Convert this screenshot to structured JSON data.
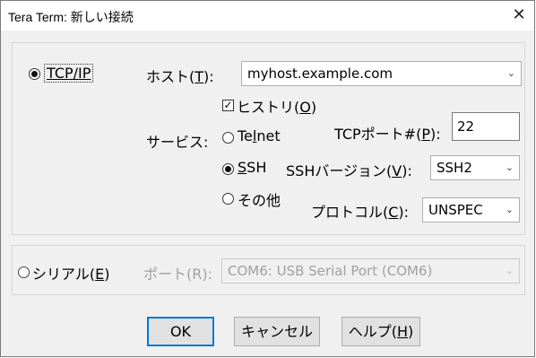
{
  "window": {
    "title": "Tera Term: 新しい接続",
    "close_glyph": "✕"
  },
  "tcpip": {
    "label": "TCP/IP",
    "selected": true,
    "host_label_prefix": "ホスト(",
    "host_label_key": "T",
    "host_label_suffix": "):",
    "host_value": "myhost.example.com",
    "history_checked": true,
    "history_label_prefix": "ヒストリ(",
    "history_label_key": "O",
    "history_label_suffix": ")",
    "service_label": "サービス:",
    "services": [
      {
        "label_a": "Te",
        "label_key": "l",
        "label_b": "net",
        "selected": false
      },
      {
        "label_a": "",
        "label_key": "S",
        "label_b": "SH",
        "selected": true
      },
      {
        "label_a": "その他",
        "label_key": "",
        "label_b": "",
        "selected": false
      }
    ],
    "port_label_prefix": "TCPポート#(",
    "port_label_key": "P",
    "port_label_suffix": "):",
    "port_value": "22",
    "ssh_version_label_prefix": "SSHバージョン(",
    "ssh_version_label_key": "V",
    "ssh_version_label_suffix": "):",
    "ssh_version_value": "SSH2",
    "protocol_label_prefix": "プロトコル(",
    "protocol_label_key": "C",
    "protocol_label_suffix": "):",
    "protocol_value": "UNSPEC"
  },
  "serial": {
    "label_prefix": "シリアル(",
    "label_key": "E",
    "label_suffix": ")",
    "selected": false,
    "port_label": "ポート(R):",
    "port_value": "COM6: USB Serial Port (COM6)"
  },
  "buttons": {
    "ok": "OK",
    "cancel": "キャンセル",
    "help_prefix": "ヘルプ(",
    "help_key": "H",
    "help_suffix": ")"
  }
}
